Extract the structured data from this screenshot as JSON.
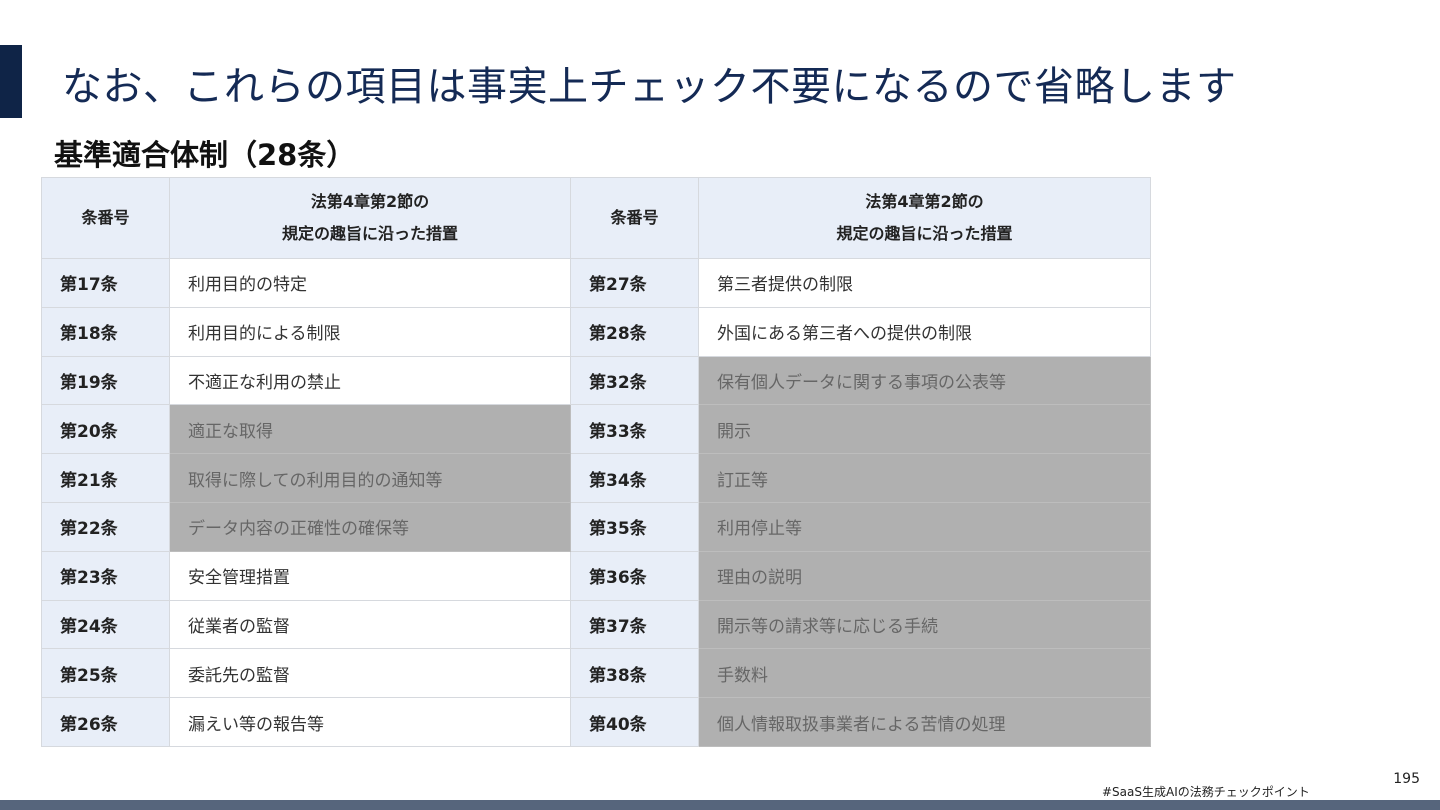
{
  "slide": {
    "title": "なお、これらの項目は事実上チェック不要になるので省略します",
    "section_title": "基準適合体制（28条）",
    "page_number": "195",
    "hashtag": "#SaaS生成AIの法務チェックポイント"
  },
  "colors": {
    "accent": "#0f2447",
    "title_text": "#142a55",
    "header_bg": "#e8eef8",
    "omitted_bg": "#b0b0b0",
    "footer_band": "#56657c"
  },
  "table": {
    "headers": {
      "num": "条番号",
      "title_line1": "法第4章第2節の",
      "title_line2": "規定の趣旨に沿った措置"
    },
    "rows": [
      {
        "left_num": "第17条",
        "left_title": "利用目的の特定",
        "right_num": "第27条",
        "right_title": "第三者提供の制限",
        "left_omitted": false,
        "right_omitted": false
      },
      {
        "left_num": "第18条",
        "left_title": "利用目的による制限",
        "right_num": "第28条",
        "right_title": "外国にある第三者への提供の制限",
        "left_omitted": false,
        "right_omitted": false
      },
      {
        "left_num": "第19条",
        "left_title": "不適正な利用の禁止",
        "right_num": "第32条",
        "right_title": "保有個人データに関する事項の公表等",
        "left_omitted": false,
        "right_omitted": true
      },
      {
        "left_num": "第20条",
        "left_title": "適正な取得",
        "right_num": "第33条",
        "right_title": "開示",
        "left_omitted": true,
        "right_omitted": true
      },
      {
        "left_num": "第21条",
        "left_title": "取得に際しての利用目的の通知等",
        "right_num": "第34条",
        "right_title": "訂正等",
        "left_omitted": true,
        "right_omitted": true
      },
      {
        "left_num": "第22条",
        "left_title": "データ内容の正確性の確保等",
        "right_num": "第35条",
        "right_title": "利用停止等",
        "left_omitted": true,
        "right_omitted": true
      },
      {
        "left_num": "第23条",
        "left_title": "安全管理措置",
        "right_num": "第36条",
        "right_title": "理由の説明",
        "left_omitted": false,
        "right_omitted": true
      },
      {
        "left_num": "第24条",
        "left_title": "従業者の監督",
        "right_num": "第37条",
        "right_title": "開示等の請求等に応じる手続",
        "left_omitted": false,
        "right_omitted": true
      },
      {
        "left_num": "第25条",
        "left_title": "委託先の監督",
        "right_num": "第38条",
        "right_title": "手数料",
        "left_omitted": false,
        "right_omitted": true
      },
      {
        "left_num": "第26条",
        "left_title": "漏えい等の報告等",
        "right_num": "第40条",
        "right_title": "個人情報取扱事業者による苦情の処理",
        "left_omitted": false,
        "right_omitted": true
      }
    ]
  }
}
